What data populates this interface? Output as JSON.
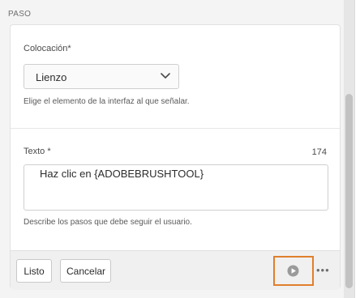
{
  "section": {
    "heading": "PASO"
  },
  "placement": {
    "label": "Colocación*",
    "value": "Lienzo",
    "help": "Elige el elemento de la interfaz al que señalar."
  },
  "text_field": {
    "label": "Texto *",
    "char_count": "174",
    "value": "Haz clic en {ADOBEBRUSHTOOL}",
    "help": "Describe los pasos que debe seguir el usuario."
  },
  "footer": {
    "done_label": "Listo",
    "cancel_label": "Cancelar",
    "more_glyph": "•••"
  },
  "icons": {
    "dropdown": "chevron-down-icon",
    "play": "play-circle-icon",
    "more": "more-horizontal-icon"
  },
  "colors": {
    "highlight": "#e07f2c",
    "panel_bg": "#ffffff",
    "footer_bg": "#f0f0f0"
  }
}
